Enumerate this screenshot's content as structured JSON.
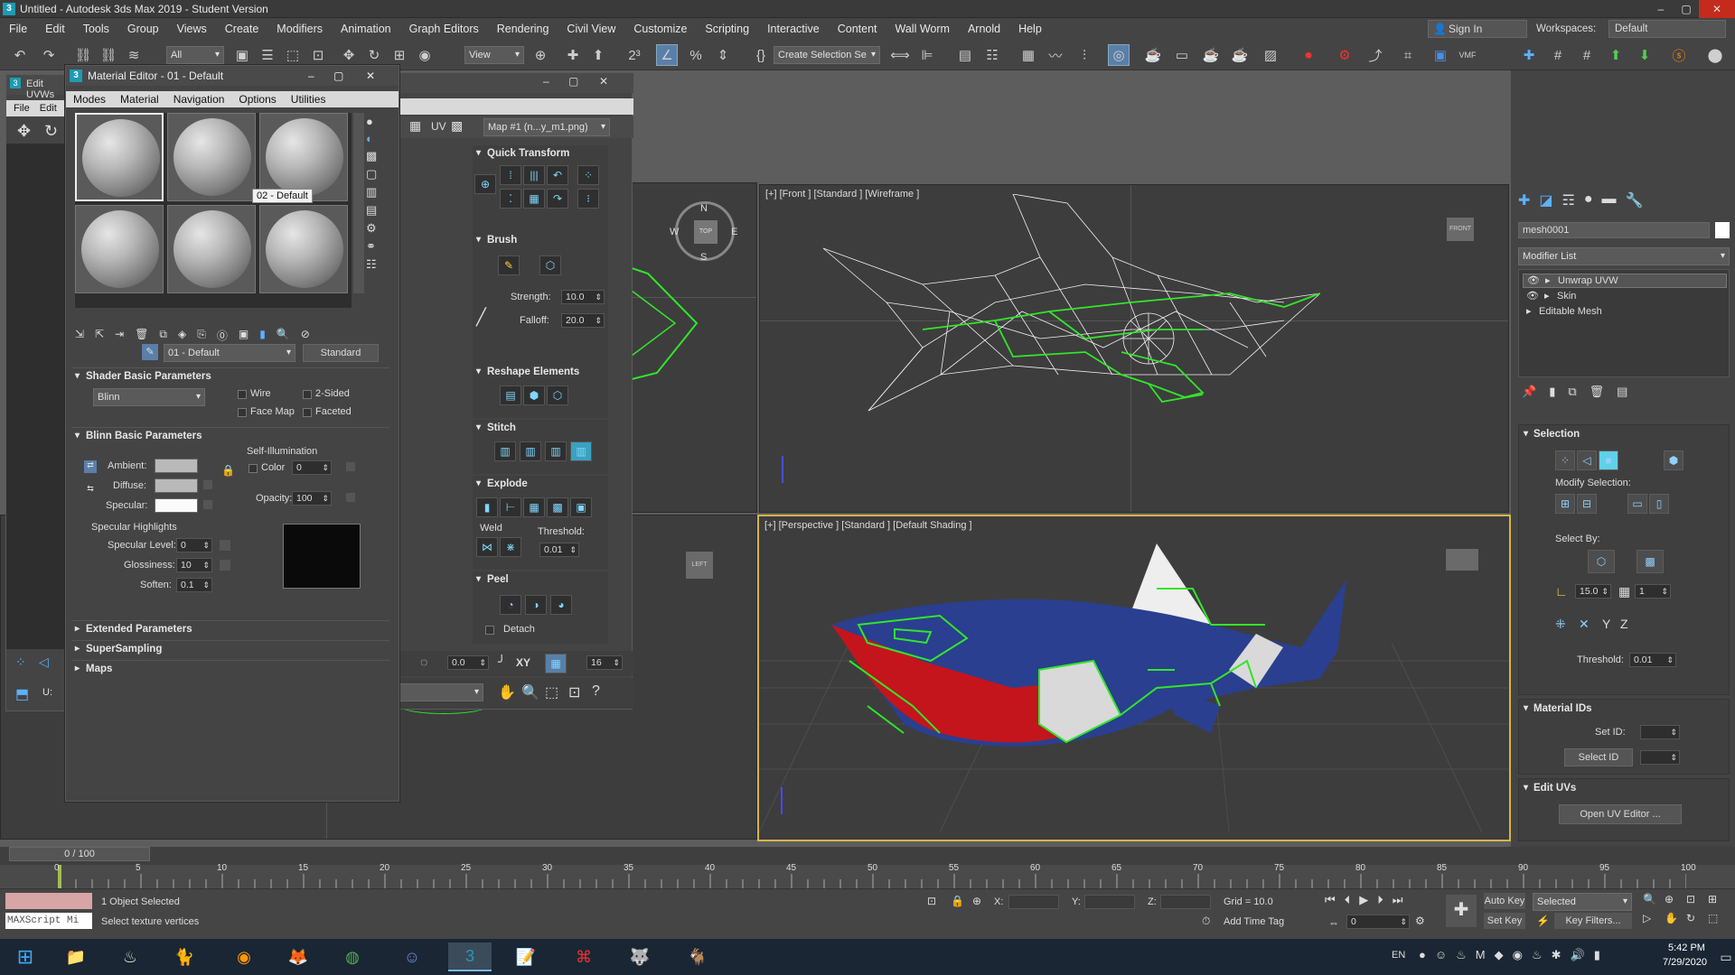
{
  "titlebar": {
    "title": "Untitled - Autodesk 3ds Max 2019 - Student Version",
    "icon_letter": "3"
  },
  "menu": [
    "File",
    "Edit",
    "Tools",
    "Group",
    "Views",
    "Create",
    "Modifiers",
    "Animation",
    "Graph Editors",
    "Rendering",
    "Civil View",
    "Customize",
    "Scripting",
    "Interactive",
    "Content",
    "Wall Worm",
    "Arnold",
    "Help"
  ],
  "signin": {
    "label": "Sign In"
  },
  "workspace": {
    "label": "Workspaces:",
    "value": "Default"
  },
  "toolbar": {
    "filter": "All",
    "view": "View",
    "selection_set": "Create Selection Se"
  },
  "viewports": {
    "front": {
      "label": "[+] [Front ] [Standard ] [Wireframe ]",
      "cube": "FRONT"
    },
    "perspective": {
      "label": "[+] [Perspective ] [Standard ] [Default Shading ]"
    },
    "top": {
      "compass": [
        "N",
        "W",
        "E",
        "S"
      ],
      "cube": "TOP"
    },
    "left": {
      "cube": "LEFT"
    }
  },
  "command_panel": {
    "object_name": "mesh0001",
    "modifier_list": "Modifier List",
    "stack": [
      "Unwrap UVW",
      "Skin",
      "Editable Mesh"
    ],
    "selection": {
      "title": "Selection",
      "modify_selection": "Modify Selection:",
      "select_by": "Select By:",
      "angle": "15.0",
      "count": "1",
      "threshold_label": "Threshold:",
      "threshold": "0.01"
    },
    "material_ids": {
      "title": "Material IDs",
      "set_id": "Set ID:",
      "select_id": "Select ID"
    },
    "edit_uvs": {
      "title": "Edit UVs",
      "open_uv_editor": "Open UV Editor ..."
    }
  },
  "material_editor": {
    "title": "Material Editor - 01 - Default",
    "menu": [
      "Modes",
      "Material",
      "Navigation",
      "Options",
      "Utilities"
    ],
    "tooltip": "02 - Default",
    "material_name": "01 - Default",
    "material_type": "Standard",
    "shader_basic": {
      "title": "Shader Basic Parameters",
      "shader": "Blinn",
      "wire": "Wire",
      "two_sided": "2-Sided",
      "face_map": "Face Map",
      "faceted": "Faceted"
    },
    "blinn_basic": {
      "title": "Blinn Basic Parameters",
      "ambient": "Ambient:",
      "diffuse": "Diffuse:",
      "specular": "Specular:",
      "self_illum": "Self-Illumination",
      "color": "Color",
      "color_val": "0",
      "opacity": "Opacity:",
      "opacity_val": "100",
      "spec_highlights": "Specular Highlights",
      "spec_level": "Specular Level:",
      "spec_level_val": "0",
      "glossiness": "Glossiness:",
      "glossiness_val": "10",
      "soften": "Soften:",
      "soften_val": "0.1"
    },
    "extended": "Extended Parameters",
    "supersampling": "SuperSampling",
    "maps": "Maps"
  },
  "uv_editor": {
    "title": "Edit UVWs",
    "menu": [
      "File",
      "Edit"
    ],
    "map_dropdown": "Map #1 (n...y_m1.png)",
    "uv_label": "UV",
    "quick_transform": "Quick Transform",
    "brush": {
      "title": "Brush",
      "strength": "Strength:",
      "strength_val": "10.0",
      "falloff": "Falloff:",
      "falloff_val": "20.0"
    },
    "reshape": "Reshape Elements",
    "stitch": "Stitch",
    "explode": {
      "title": "Explode",
      "weld": "Weld",
      "threshold": "Threshold:",
      "threshold_val": "0.01"
    },
    "peel": {
      "title": "Peel",
      "detach": "Detach"
    },
    "bottom": {
      "value": "0.0",
      "axis": "XY",
      "num": "16",
      "u": "U:"
    }
  },
  "timeline": {
    "frame": "0 / 100",
    "ticks": [
      "0",
      "5",
      "10",
      "15",
      "20",
      "25",
      "30",
      "35",
      "40",
      "45",
      "50",
      "55",
      "60",
      "65",
      "70",
      "75",
      "80",
      "85",
      "90",
      "95",
      "100"
    ]
  },
  "status": {
    "objects": "1 Object Selected",
    "prompt": "Select texture vertices",
    "maxscript": "MAXScript Mi",
    "x_label": "X:",
    "y_label": "Y:",
    "z_label": "Z:",
    "grid": "Grid = 10.0",
    "add_time_tag": "Add Time Tag",
    "auto_key": "Auto Key",
    "set_key": "Set Key",
    "selected": "Selected",
    "key_filters": "Key Filters...",
    "frame": "0"
  },
  "taskbar": {
    "lang": "EN",
    "time": "5:42 PM",
    "date": "7/29/2020"
  },
  "colors": {
    "accent": "#5a7fa8",
    "active_viewport": "#d5b64a",
    "shark_blue": "#2a3f8f",
    "shark_red": "#c4151c",
    "uv_green": "#31e62a"
  }
}
